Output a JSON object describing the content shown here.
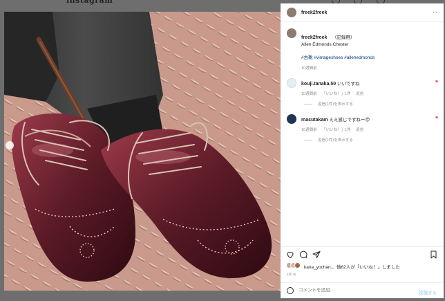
{
  "background": {
    "title": "instagram"
  },
  "header": {
    "username": "freek2freek",
    "more": "···"
  },
  "caption": {
    "username": "freek2freek",
    "note": "（記録用）",
    "text": "Allen Edmonds Chester",
    "hashtags": [
      "#古靴",
      "#vintageshoes",
      "#allenedmonds"
    ],
    "time": "10週間前"
  },
  "comments": [
    {
      "username": "kouji.tanaka.50",
      "text": "いいですね",
      "time": "10週間前",
      "likes": "「いいね！」1件",
      "reply": "返信",
      "view_replies": "返信(1件)を表示する"
    },
    {
      "username": "masutakam",
      "text": "ええ感じですねー😍",
      "time": "10週間前",
      "likes": "「いいね！」1件",
      "reply": "返信",
      "view_replies": "返信(1件)を表示する"
    }
  ],
  "likes_line": {
    "user": "kana_yochan.",
    "middle": "、他62",
    "suffix": "人が「いいね！」しました"
  },
  "date": "4月 26",
  "comment_box": {
    "placeholder": "コメントを追加...",
    "post": "投稿する"
  },
  "colors": {
    "like_red": "#ed4956",
    "hashtag": "#00376b",
    "muted": "#8e8e8e",
    "post_disabled": "#b2dffc"
  }
}
